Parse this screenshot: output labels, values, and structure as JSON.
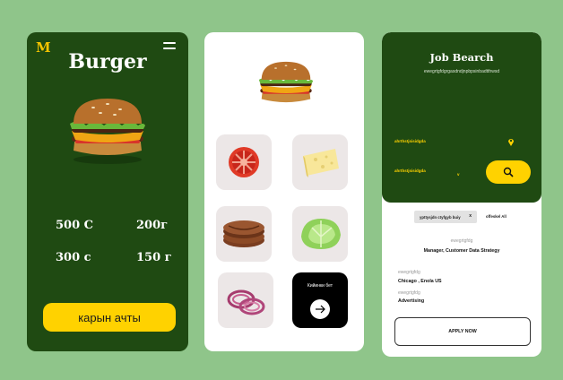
{
  "colors": {
    "background": "#8fc58a",
    "brand_green": "#1f4a12",
    "accent_yellow": "#ffd200"
  },
  "menu_card": {
    "logo": "M",
    "title": "Burger",
    "stats": [
      "500 C",
      "200г",
      "300 c",
      "150 г"
    ],
    "order_button": "карын ачты"
  },
  "ingredients_card": {
    "icons": [
      "burger-icon",
      "tomato-icon",
      "cheese-icon",
      "patty-icon",
      "lettuce-icon",
      "onion-icon",
      "arrow-right-icon"
    ],
    "next_label": "Кийинки бет"
  },
  "job_card": {
    "title": "Job Bearch",
    "subtitle": "ewegrtgfdgrgasdndjnpbpsinbadtthwsd",
    "location_label": "ahrthstjsisidgda",
    "filter_label": "ahrthstjsisidgda",
    "filter_chevron": "v",
    "search_icon": "search-icon",
    "chip": "ypttysjdn ctyfgyb buiy",
    "chip_close": "x",
    "off_label": "offeskel All",
    "company_label": "ewegrtgfdg",
    "job_title": "Manager, Customer Data Strategy",
    "location_caption": "ewegrtgfdg",
    "location_value": "Chicago , Enola  US",
    "category_caption": "ewegrtgfdg",
    "category_value": "Advertising",
    "apply_button": "APPLY NOW"
  }
}
